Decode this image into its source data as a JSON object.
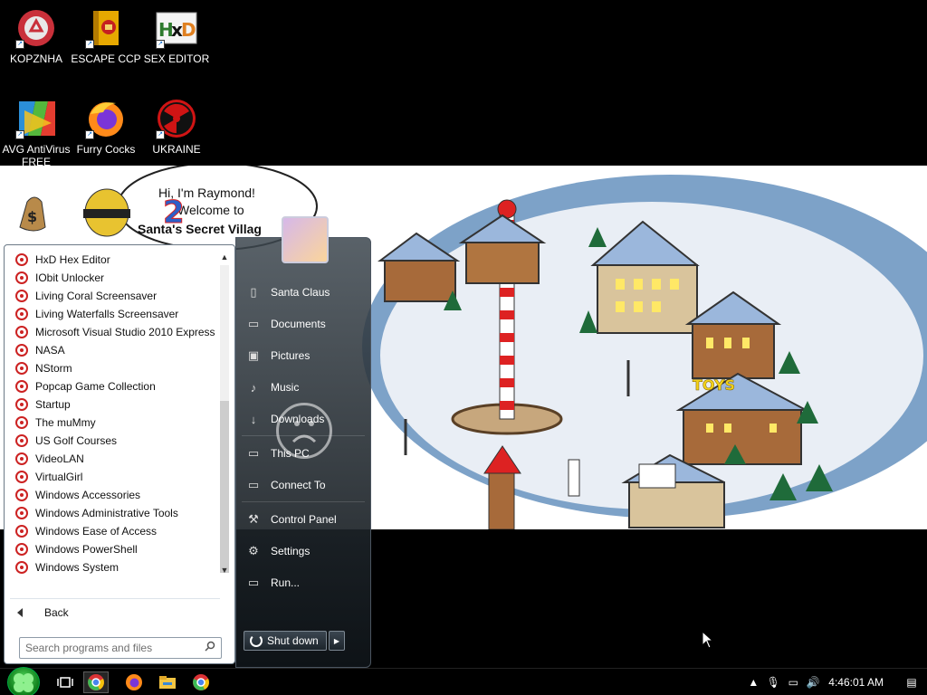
{
  "desktop": {
    "icons": [
      {
        "label": "KOPZNHA",
        "icon": "recycle-icon"
      },
      {
        "label": "ESCAPE CCP",
        "icon": "lock-box-icon"
      },
      {
        "label": "SEX EDITOR",
        "icon": "hxd-icon"
      },
      {
        "label": "AVG AntiVirus FREE",
        "icon": "avg-icon"
      },
      {
        "label": "Furry Cocks",
        "icon": "firefox-icon"
      },
      {
        "label": "UKRAINE",
        "icon": "radiation-icon"
      }
    ]
  },
  "wallpaper": {
    "speech_line1": "Hi, I'm Raymond!",
    "speech_line2": "Welcome to",
    "speech_line3": "Santa's Secret Villag",
    "badge": "2",
    "sign": "TOYS"
  },
  "start_menu": {
    "programs": [
      "HxD Hex Editor",
      "IObit Unlocker",
      "Living Coral Screensaver",
      "Living Waterfalls Screensaver",
      "Microsoft Visual Studio 2010 Express",
      "NASA",
      "NStorm",
      "Popcap Game Collection",
      "Startup",
      "The muMmy",
      "US Golf Courses",
      "VideoLAN",
      "VirtualGirl",
      "Windows Accessories",
      "Windows Administrative Tools",
      "Windows Ease of Access",
      "Windows PowerShell",
      "Windows System"
    ],
    "back_label": "Back",
    "search_placeholder": "Search programs and files",
    "right_links": {
      "user": "Santa Claus",
      "documents": "Documents",
      "pictures": "Pictures",
      "music": "Music",
      "downloads": "Downloads",
      "this_pc": "This PC",
      "connect_to": "Connect To",
      "control_panel": "Control Panel",
      "settings": "Settings",
      "run": "Run..."
    },
    "shutdown_label": "Shut down"
  },
  "taskbar": {
    "clock": "4:46:01 AM",
    "pinned": [
      "task-view-icon",
      "chrome-icon",
      "firefox-icon",
      "file-explorer-icon",
      "chrome-icon"
    ]
  }
}
